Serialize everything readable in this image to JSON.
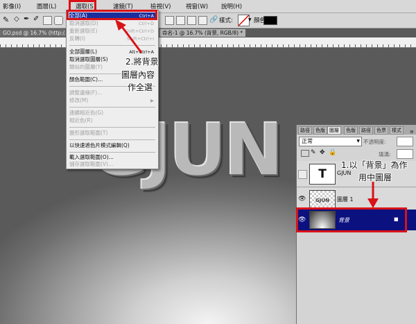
{
  "menubar": {
    "items": [
      {
        "label": "影像(I)"
      },
      {
        "label": "圖層(L)"
      },
      {
        "label": "選取(S)"
      },
      {
        "label": "濾鏡(T)"
      },
      {
        "label": "檢視(V)"
      },
      {
        "label": "視窗(W)"
      },
      {
        "label": "說明(H)"
      }
    ]
  },
  "optionsbar": {
    "style_label": "樣式:",
    "color_label": "顏色:",
    "color_swatch": "#000000"
  },
  "tabs": [
    {
      "label": "GO.psd @ 16.7% (http://ww..."
    },
    {
      "label": "命名-1 @ 16.7% (背景, RGB/8) *"
    }
  ],
  "canvas": {
    "text": "GJUN"
  },
  "select_menu": {
    "items": [
      {
        "label": "全部(A)",
        "shortcut": "Ctrl+A",
        "state": "selected"
      },
      {
        "label": "取消選取(D)",
        "shortcut": "Ctrl+D",
        "state": "disabled"
      },
      {
        "label": "重新選取(E)",
        "shortcut": "Shift+Ctrl+D",
        "state": "disabled"
      },
      {
        "label": "反轉(I)",
        "shortcut": "Shift+Ctrl+I",
        "state": "disabled"
      },
      {
        "label": "全部圖層(L)",
        "shortcut": "Alt+Ctrl+A",
        "state": "normal"
      },
      {
        "label": "取消選取圖層(S)",
        "shortcut": "",
        "state": "normal"
      },
      {
        "label": "類似的圖層(Y)",
        "shortcut": "",
        "state": "disabled"
      },
      {
        "label": "顏色範圍(C)...",
        "shortcut": "",
        "state": "normal"
      },
      {
        "label": "調整邊緣(F)...",
        "shortcut": "",
        "state": "disabled"
      },
      {
        "label": "修改(M)",
        "shortcut": "",
        "state": "disabled"
      },
      {
        "label": "連續相近色(G)",
        "shortcut": "",
        "state": "disabled"
      },
      {
        "label": "相近色(R)",
        "shortcut": "",
        "state": "disabled"
      },
      {
        "label": "變形選取範圍(T)",
        "shortcut": "",
        "state": "disabled"
      },
      {
        "label": "以快速遮色片模式編輯(Q)",
        "shortcut": "",
        "state": "normal"
      },
      {
        "label": "載入選取範圍(O)...",
        "shortcut": "",
        "state": "normal"
      },
      {
        "label": "儲存選取範圍(V)...",
        "shortcut": "",
        "state": "disabled"
      }
    ]
  },
  "annotations": {
    "step2": [
      "2.將背景",
      "圖層內容",
      "作全選"
    ],
    "step1": [
      "1.以「背景」為作",
      "用中圖層"
    ]
  },
  "layers_panel": {
    "tabs": [
      "路徑",
      "色版",
      "圖層",
      "色版",
      "路徑",
      "色票",
      "樣式"
    ],
    "blend_mode": "正常",
    "opacity_label": "不透明度:",
    "fill_label": "填滿:",
    "layers": [
      {
        "name": "GJUN",
        "thumb_text": "T",
        "state": "normal"
      },
      {
        "name": "圖層 1",
        "thumb_text": "GJUN",
        "state": "normal"
      },
      {
        "name": "背景",
        "thumb_text": "",
        "state": "selected"
      }
    ]
  },
  "colors": {
    "accent_red": "#d81317",
    "selection_blue": "#1b2f9c",
    "layer_selected": "#0c1180"
  }
}
